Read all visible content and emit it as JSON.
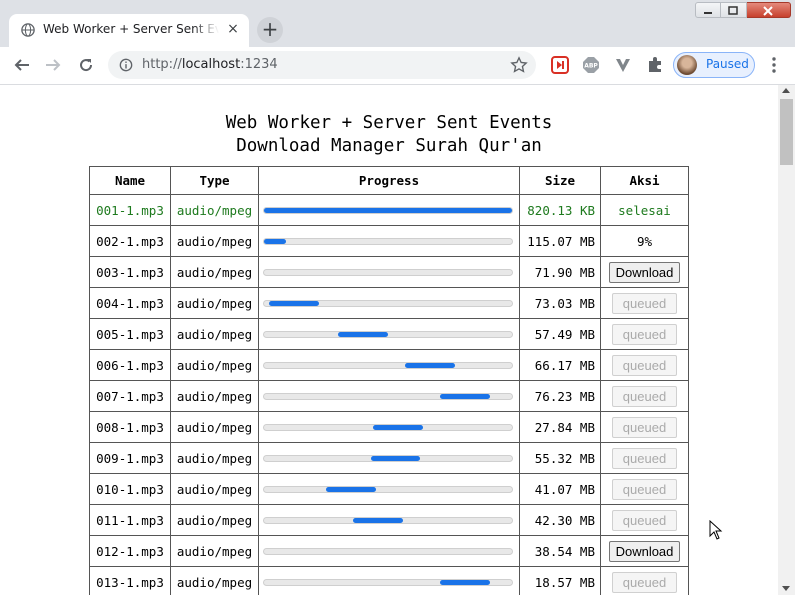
{
  "browser": {
    "tab_title": "Web Worker + Server Sent Events",
    "tab_close": "×",
    "new_tab": "+",
    "url_scheme": "http://",
    "url_host": "localhost",
    "url_port": ":1234",
    "profile_label": "Paused",
    "extensions": [
      "media-ext-icon",
      "adblock-icon",
      "vpn-icon",
      "puzzle-icon"
    ]
  },
  "page": {
    "title_line1": "Web Worker + Server Sent Events",
    "title_line2": "Download Manager Surah Qur'an"
  },
  "table": {
    "headers": [
      "Name",
      "Type",
      "Progress",
      "Size",
      "Aksi"
    ],
    "rows": [
      {
        "name": "001-1.mp3",
        "type": "audio/mpeg",
        "size": "820.13 KB",
        "action": "selesai",
        "action_kind": "text",
        "done": true,
        "progress_start": 0,
        "progress_end": 1
      },
      {
        "name": "002-1.mp3",
        "type": "audio/mpeg",
        "size": "115.07 MB",
        "action": "9%",
        "action_kind": "text",
        "done": false,
        "progress_start": 0,
        "progress_end": 0.09
      },
      {
        "name": "003-1.mp3",
        "type": "audio/mpeg",
        "size": "71.90 MB",
        "action": "Download",
        "action_kind": "button",
        "done": false,
        "progress_start": 0,
        "progress_end": 0
      },
      {
        "name": "004-1.mp3",
        "type": "audio/mpeg",
        "size": "73.03 MB",
        "action": "queued",
        "action_kind": "disabled",
        "done": false,
        "progress_start": 0.02,
        "progress_end": 0.22
      },
      {
        "name": "005-1.mp3",
        "type": "audio/mpeg",
        "size": "57.49 MB",
        "action": "queued",
        "action_kind": "disabled",
        "done": false,
        "progress_start": 0.3,
        "progress_end": 0.5
      },
      {
        "name": "006-1.mp3",
        "type": "audio/mpeg",
        "size": "66.17 MB",
        "action": "queued",
        "action_kind": "disabled",
        "done": false,
        "progress_start": 0.57,
        "progress_end": 0.77
      },
      {
        "name": "007-1.mp3",
        "type": "audio/mpeg",
        "size": "76.23 MB",
        "action": "queued",
        "action_kind": "disabled",
        "done": false,
        "progress_start": 0.71,
        "progress_end": 0.91
      },
      {
        "name": "008-1.mp3",
        "type": "audio/mpeg",
        "size": "27.84 MB",
        "action": "queued",
        "action_kind": "disabled",
        "done": false,
        "progress_start": 0.44,
        "progress_end": 0.64
      },
      {
        "name": "009-1.mp3",
        "type": "audio/mpeg",
        "size": "55.32 MB",
        "action": "queued",
        "action_kind": "disabled",
        "done": false,
        "progress_start": 0.43,
        "progress_end": 0.63
      },
      {
        "name": "010-1.mp3",
        "type": "audio/mpeg",
        "size": "41.07 MB",
        "action": "queued",
        "action_kind": "disabled",
        "done": false,
        "progress_start": 0.25,
        "progress_end": 0.45
      },
      {
        "name": "011-1.mp3",
        "type": "audio/mpeg",
        "size": "42.30 MB",
        "action": "queued",
        "action_kind": "disabled",
        "done": false,
        "progress_start": 0.36,
        "progress_end": 0.56
      },
      {
        "name": "012-1.mp3",
        "type": "audio/mpeg",
        "size": "38.54 MB",
        "action": "Download",
        "action_kind": "button",
        "done": false,
        "progress_start": 0,
        "progress_end": 0
      },
      {
        "name": "013-1.mp3",
        "type": "audio/mpeg",
        "size": "18.57 MB",
        "action": "queued",
        "action_kind": "disabled",
        "done": false,
        "progress_start": 0.71,
        "progress_end": 0.91
      }
    ]
  },
  "colors": {
    "accent": "#1a73e8",
    "done_text": "#1e7a1e"
  }
}
